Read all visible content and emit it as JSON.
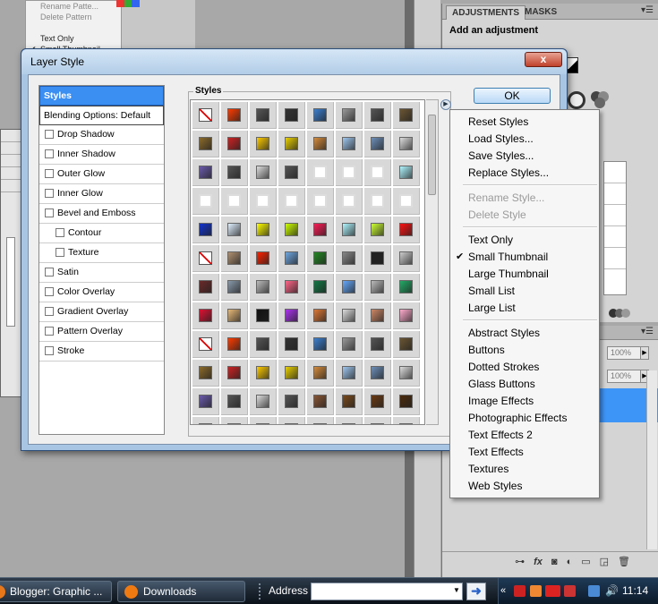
{
  "background_app": {
    "menu_items": [
      {
        "label": "Rename Patte...",
        "disabled": true
      },
      {
        "label": "Delete Pattern",
        "disabled": true
      },
      {
        "label": "",
        "disabled": true
      },
      {
        "label": "Text Only",
        "disabled": false
      },
      {
        "label": "Small Thumbnail",
        "disabled": false,
        "checked": true
      }
    ],
    "adjustments_tab": "ADJUSTMENTS",
    "masks_tab": "MASKS",
    "add_adjustment": "Add an adjustment",
    "opacity_value": "100%",
    "fill_value": "100%"
  },
  "dialog": {
    "title": "Layer Style",
    "close_glyph": "x",
    "ok_label": "OK",
    "styles_heading": "Styles",
    "flyout_glyph": "▶",
    "style_list": [
      {
        "label": "Styles",
        "type": "selected"
      },
      {
        "label": "Blending Options: Default",
        "type": "plain"
      },
      {
        "label": "Drop Shadow",
        "type": "check",
        "indent": 0
      },
      {
        "label": "Inner Shadow",
        "type": "check",
        "indent": 0
      },
      {
        "label": "Outer Glow",
        "type": "check",
        "indent": 0
      },
      {
        "label": "Inner Glow",
        "type": "check",
        "indent": 0
      },
      {
        "label": "Bevel and Emboss",
        "type": "check",
        "indent": 0
      },
      {
        "label": "Contour",
        "type": "check",
        "indent": 1
      },
      {
        "label": "Texture",
        "type": "check",
        "indent": 1
      },
      {
        "label": "Satin",
        "type": "check",
        "indent": 0
      },
      {
        "label": "Color Overlay",
        "type": "check",
        "indent": 0
      },
      {
        "label": "Gradient Overlay",
        "type": "check",
        "indent": 0
      },
      {
        "label": "Pattern Overlay",
        "type": "check",
        "indent": 0
      },
      {
        "label": "Stroke",
        "type": "check",
        "indent": 0
      }
    ],
    "swatch_rows": [
      [
        "#ffffff|none",
        "#ff3b00",
        "#555555",
        "#333333",
        "#3a7fd0",
        "#9a9a9a",
        "#555555",
        "#6b5532"
      ],
      [
        "#8a6a2a",
        "#cc2222",
        "#ffcc00",
        "#e8d000",
        "#d48a3a",
        "#9fc8f0",
        "#6d8fb8",
        "#dddddd"
      ],
      [
        "#6a5aaa",
        "#555555",
        "#dddddd",
        "#555555",
        "#ffffff",
        "#ffffff",
        "#ffffff",
        "#aef6ff"
      ],
      [
        "#ffffff",
        "#ffffff",
        "#ffffff",
        "#ffffff",
        "#ffffff",
        "#ffffff",
        "#ffffff",
        "#ffffff"
      ],
      [
        "#1133cc",
        "#dff0ff",
        "#ffff00",
        "#ccff00",
        "#ff1a55",
        "#aef6ff",
        "#ccff33",
        "#ff1111"
      ],
      [
        "#ffffff|none",
        "#b09070",
        "#ff2200",
        "#6fa8e0",
        "#228822",
        "#888888",
        "#222222",
        "#cccccc"
      ],
      [
        "#6a2a2a",
        "#8899aa",
        "#bbbbbb",
        "#ff6688",
        "#117744",
        "#66aaff",
        "#bbbbbb",
        "#22aa66"
      ],
      [
        "#dd1133",
        "#e6b877",
        "#111111",
        "#aa33ee",
        "#dd7733",
        "#dddddd",
        "#cc8866",
        "#ffaacc"
      ],
      [
        "#ffffff|none",
        "#ff3b00",
        "#555555",
        "#333333",
        "#3a7fd0",
        "#9a9a9a",
        "#555555",
        "#6b5532"
      ],
      [
        "#8a6a2a",
        "#cc2222",
        "#ffcc00",
        "#e8d000",
        "#d48a3a",
        "#9fc8f0",
        "#6d8fb8",
        "#dddddd"
      ],
      [
        "#6a5aaa",
        "#555555",
        "#dddddd",
        "#555555",
        "#885533",
        "#7a4a1a",
        "#6a3a12",
        "#4a2a0a"
      ],
      [
        "#222222",
        "#aaaaaa",
        "#c8a070",
        "#555555",
        "#aaaaaa",
        "#cccccc",
        "#dddddd",
        "#eeeeee"
      ]
    ]
  },
  "popup_menu": {
    "items": [
      {
        "label": "Reset Styles",
        "disabled": false
      },
      {
        "label": "Load Styles...",
        "disabled": false
      },
      {
        "label": "Save Styles...",
        "disabled": false
      },
      {
        "label": "Replace Styles...",
        "disabled": false
      },
      {
        "sep": true
      },
      {
        "label": "Rename Style...",
        "disabled": true
      },
      {
        "label": "Delete Style",
        "disabled": true
      },
      {
        "sep": true
      },
      {
        "label": "Text Only",
        "disabled": false
      },
      {
        "label": "Small Thumbnail",
        "disabled": false,
        "checked": true
      },
      {
        "label": "Large Thumbnail",
        "disabled": false
      },
      {
        "label": "Small List",
        "disabled": false
      },
      {
        "label": "Large List",
        "disabled": false
      },
      {
        "sep": true
      },
      {
        "label": "Abstract Styles",
        "disabled": false
      },
      {
        "label": "Buttons",
        "disabled": false
      },
      {
        "label": "Dotted Strokes",
        "disabled": false
      },
      {
        "label": "Glass Buttons",
        "disabled": false
      },
      {
        "label": "Image Effects",
        "disabled": false
      },
      {
        "label": "Photographic Effects",
        "disabled": false
      },
      {
        "label": "Text Effects 2",
        "disabled": false
      },
      {
        "label": "Text Effects",
        "disabled": false
      },
      {
        "label": "Textures",
        "disabled": false
      },
      {
        "label": "Web Styles",
        "disabled": false
      }
    ]
  },
  "taskbar": {
    "buttons": [
      {
        "label": "Blogger: Graphic ...",
        "icon_color": "#e8771a"
      },
      {
        "label": "Downloads",
        "icon_color": "#f07a12"
      }
    ],
    "address_label": "Address",
    "address_value": "",
    "go_glyph": "➜",
    "clock": "11:14"
  }
}
